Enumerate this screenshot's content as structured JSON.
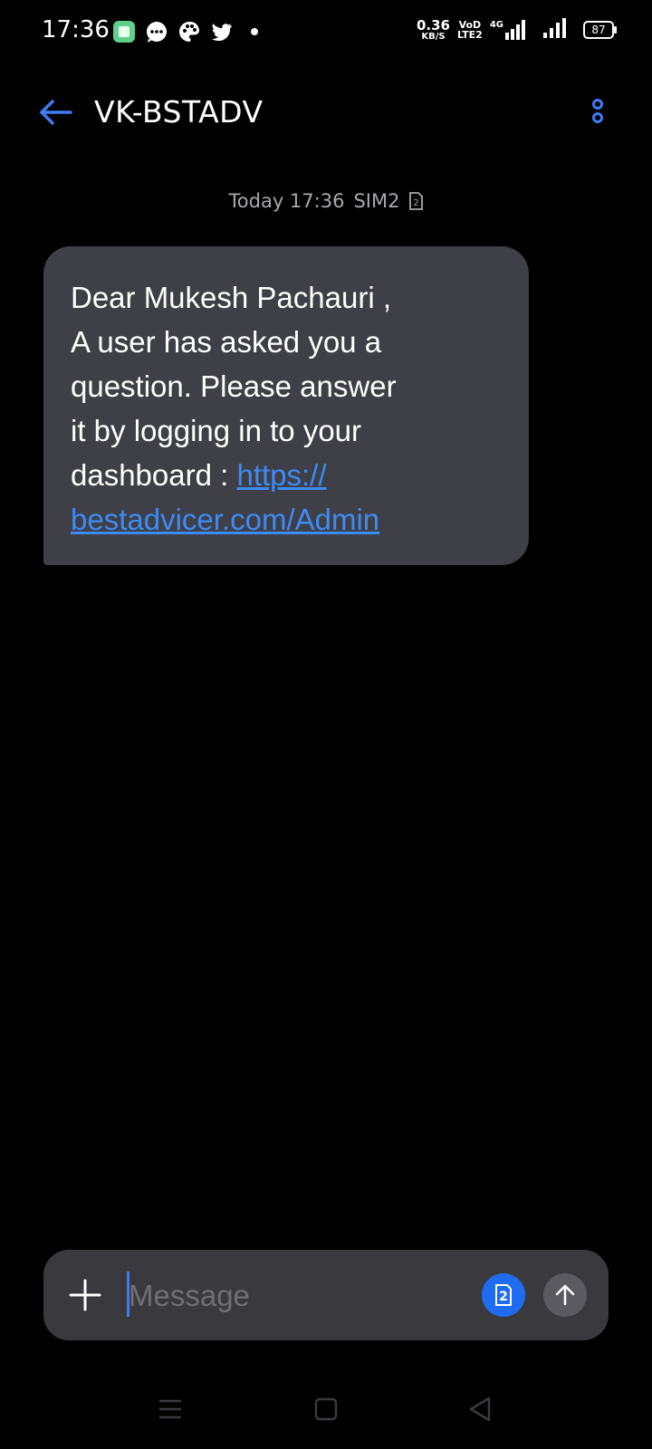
{
  "status_bar": {
    "time": "17:36",
    "net_speed_value": "0.36",
    "net_speed_unit": "KB/S",
    "volte_top": "VoD",
    "volte_bottom": "LTE2",
    "network_type": "4G",
    "battery_level": "87",
    "notification_icons": [
      "message-app-icon",
      "chat-bubble-icon",
      "palette-icon",
      "twitter-icon",
      "more-dot-icon"
    ]
  },
  "header": {
    "title": "VK-BSTADV"
  },
  "conversation": {
    "timestamp": "Today 17:36",
    "sim_label": "SIM2",
    "message": {
      "text": "Dear Mukesh Pachauri ,\nA user has asked you a\nquestion. Please answer\nit by logging in to your\ndashboard : ",
      "link_line1": "https://",
      "link_line2": "bestadvicer.com/Admin"
    }
  },
  "composer": {
    "placeholder": "Message",
    "sim_number": "2"
  },
  "colors": {
    "background": "#000000",
    "bubble": "#3e3f47",
    "accent": "#3d8bf5",
    "composer": "#3a3a3e"
  }
}
